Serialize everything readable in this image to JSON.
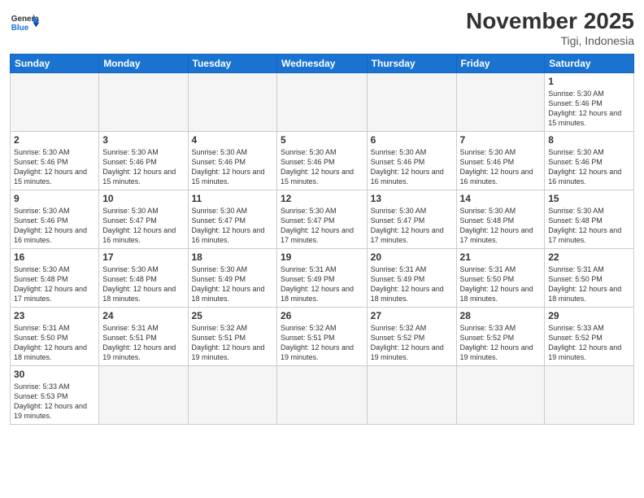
{
  "logo": {
    "general": "General",
    "blue": "Blue"
  },
  "header": {
    "title": "November 2025",
    "location": "Tigi, Indonesia"
  },
  "weekdays": [
    "Sunday",
    "Monday",
    "Tuesday",
    "Wednesday",
    "Thursday",
    "Friday",
    "Saturday"
  ],
  "days": [
    {
      "num": "",
      "empty": true
    },
    {
      "num": "",
      "empty": true
    },
    {
      "num": "",
      "empty": true
    },
    {
      "num": "",
      "empty": true
    },
    {
      "num": "",
      "empty": true
    },
    {
      "num": "",
      "empty": true
    },
    {
      "num": "1",
      "sunrise": "5:30 AM",
      "sunset": "5:46 PM",
      "daylight": "12 hours and 15 minutes."
    },
    {
      "num": "2",
      "sunrise": "5:30 AM",
      "sunset": "5:46 PM",
      "daylight": "12 hours and 15 minutes."
    },
    {
      "num": "3",
      "sunrise": "5:30 AM",
      "sunset": "5:46 PM",
      "daylight": "12 hours and 15 minutes."
    },
    {
      "num": "4",
      "sunrise": "5:30 AM",
      "sunset": "5:46 PM",
      "daylight": "12 hours and 15 minutes."
    },
    {
      "num": "5",
      "sunrise": "5:30 AM",
      "sunset": "5:46 PM",
      "daylight": "12 hours and 15 minutes."
    },
    {
      "num": "6",
      "sunrise": "5:30 AM",
      "sunset": "5:46 PM",
      "daylight": "12 hours and 16 minutes."
    },
    {
      "num": "7",
      "sunrise": "5:30 AM",
      "sunset": "5:46 PM",
      "daylight": "12 hours and 16 minutes."
    },
    {
      "num": "8",
      "sunrise": "5:30 AM",
      "sunset": "5:46 PM",
      "daylight": "12 hours and 16 minutes."
    },
    {
      "num": "9",
      "sunrise": "5:30 AM",
      "sunset": "5:46 PM",
      "daylight": "12 hours and 16 minutes."
    },
    {
      "num": "10",
      "sunrise": "5:30 AM",
      "sunset": "5:47 PM",
      "daylight": "12 hours and 16 minutes."
    },
    {
      "num": "11",
      "sunrise": "5:30 AM",
      "sunset": "5:47 PM",
      "daylight": "12 hours and 16 minutes."
    },
    {
      "num": "12",
      "sunrise": "5:30 AM",
      "sunset": "5:47 PM",
      "daylight": "12 hours and 17 minutes."
    },
    {
      "num": "13",
      "sunrise": "5:30 AM",
      "sunset": "5:47 PM",
      "daylight": "12 hours and 17 minutes."
    },
    {
      "num": "14",
      "sunrise": "5:30 AM",
      "sunset": "5:48 PM",
      "daylight": "12 hours and 17 minutes."
    },
    {
      "num": "15",
      "sunrise": "5:30 AM",
      "sunset": "5:48 PM",
      "daylight": "12 hours and 17 minutes."
    },
    {
      "num": "16",
      "sunrise": "5:30 AM",
      "sunset": "5:48 PM",
      "daylight": "12 hours and 17 minutes."
    },
    {
      "num": "17",
      "sunrise": "5:30 AM",
      "sunset": "5:48 PM",
      "daylight": "12 hours and 18 minutes."
    },
    {
      "num": "18",
      "sunrise": "5:30 AM",
      "sunset": "5:49 PM",
      "daylight": "12 hours and 18 minutes."
    },
    {
      "num": "19",
      "sunrise": "5:31 AM",
      "sunset": "5:49 PM",
      "daylight": "12 hours and 18 minutes."
    },
    {
      "num": "20",
      "sunrise": "5:31 AM",
      "sunset": "5:49 PM",
      "daylight": "12 hours and 18 minutes."
    },
    {
      "num": "21",
      "sunrise": "5:31 AM",
      "sunset": "5:50 PM",
      "daylight": "12 hours and 18 minutes."
    },
    {
      "num": "22",
      "sunrise": "5:31 AM",
      "sunset": "5:50 PM",
      "daylight": "12 hours and 18 minutes."
    },
    {
      "num": "23",
      "sunrise": "5:31 AM",
      "sunset": "5:50 PM",
      "daylight": "12 hours and 18 minutes."
    },
    {
      "num": "24",
      "sunrise": "5:31 AM",
      "sunset": "5:51 PM",
      "daylight": "12 hours and 19 minutes."
    },
    {
      "num": "25",
      "sunrise": "5:32 AM",
      "sunset": "5:51 PM",
      "daylight": "12 hours and 19 minutes."
    },
    {
      "num": "26",
      "sunrise": "5:32 AM",
      "sunset": "5:51 PM",
      "daylight": "12 hours and 19 minutes."
    },
    {
      "num": "27",
      "sunrise": "5:32 AM",
      "sunset": "5:52 PM",
      "daylight": "12 hours and 19 minutes."
    },
    {
      "num": "28",
      "sunrise": "5:33 AM",
      "sunset": "5:52 PM",
      "daylight": "12 hours and 19 minutes."
    },
    {
      "num": "29",
      "sunrise": "5:33 AM",
      "sunset": "5:52 PM",
      "daylight": "12 hours and 19 minutes."
    },
    {
      "num": "30",
      "sunrise": "5:33 AM",
      "sunset": "5:53 PM",
      "daylight": "12 hours and 19 minutes."
    }
  ]
}
